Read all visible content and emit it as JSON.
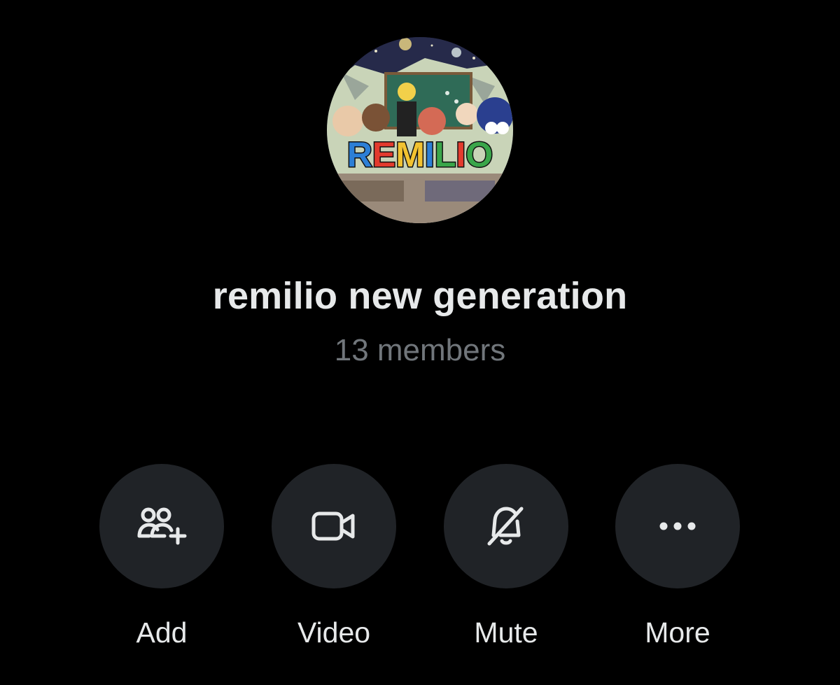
{
  "group": {
    "name": "remilio new generation",
    "members": "13 members",
    "avatar_logo_text": "REMILIO"
  },
  "actions": [
    {
      "label": "Add",
      "icon": "add-people-icon"
    },
    {
      "label": "Video",
      "icon": "video-camera-icon"
    },
    {
      "label": "Mute",
      "icon": "bell-muted-icon"
    },
    {
      "label": "More",
      "icon": "more-dots-icon"
    }
  ],
  "colors": {
    "background": "#000000",
    "title": "#e7e9ea",
    "subtitle": "#71767b",
    "button": "#202327"
  }
}
